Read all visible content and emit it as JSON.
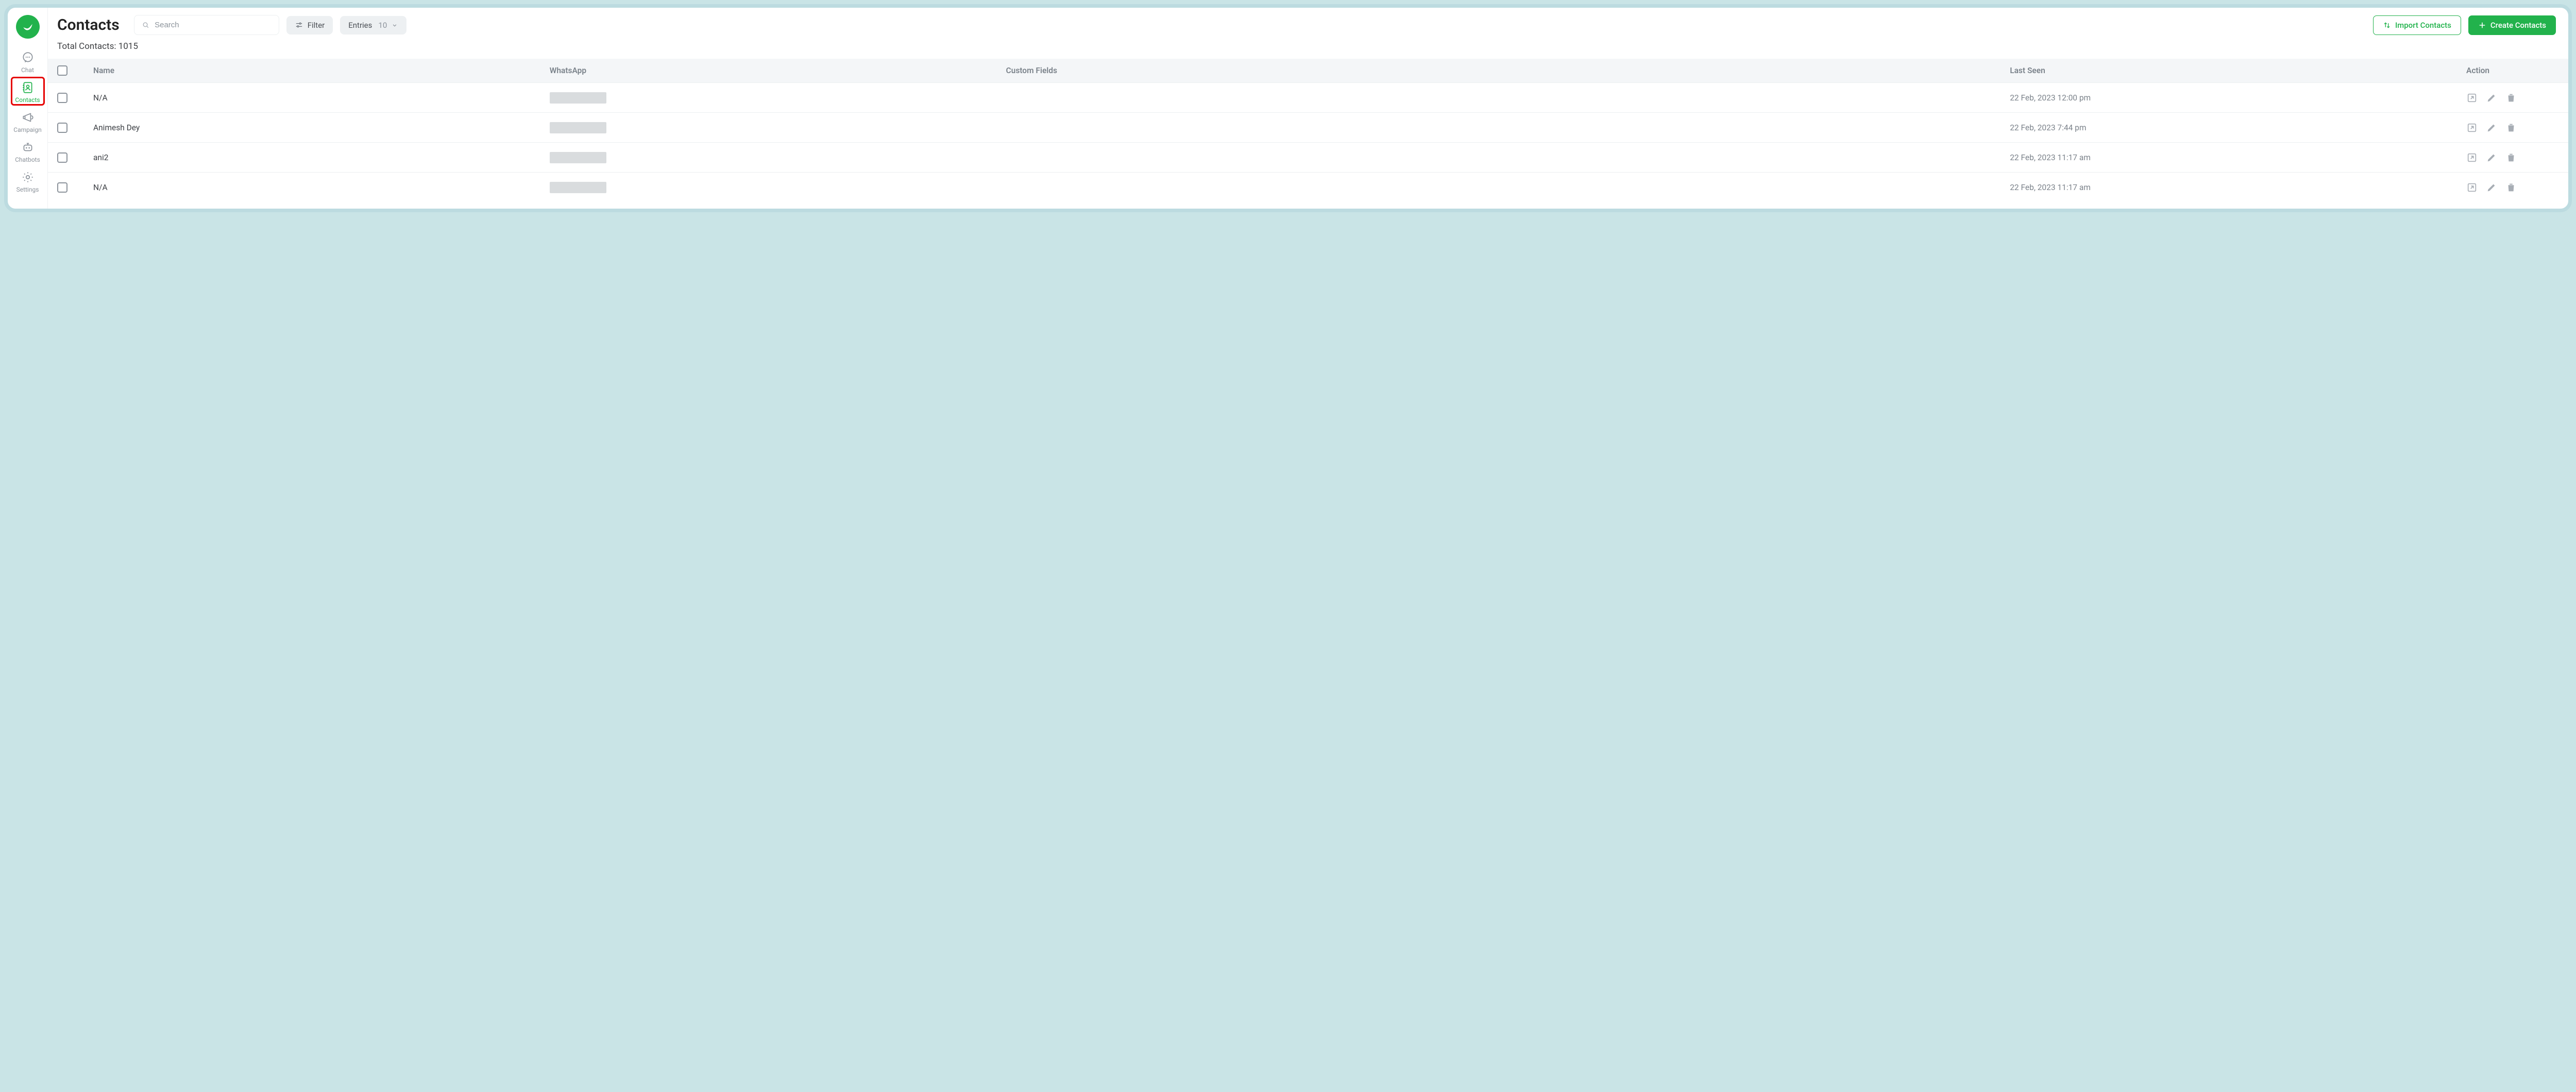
{
  "sidebar": {
    "items": [
      {
        "icon": "chat",
        "label": "Chat"
      },
      {
        "icon": "contacts",
        "label": "Contacts",
        "active": true,
        "highlight": true
      },
      {
        "icon": "campaign",
        "label": "Campaign"
      },
      {
        "icon": "chatbots",
        "label": "Chatbots"
      },
      {
        "icon": "settings",
        "label": "Settings"
      }
    ]
  },
  "header": {
    "title": "Contacts",
    "search_placeholder": "Search",
    "filter_label": "Filter",
    "entries_label": "Entries",
    "entries_value": "10",
    "import_label": "Import Contacts",
    "create_label": "Create Contacts"
  },
  "summary": {
    "total_label": "Total Contacts:",
    "total_value": "1015"
  },
  "table": {
    "columns": [
      "",
      "Name",
      "WhatsApp",
      "Custom Fields",
      "Last Seen",
      "Action"
    ],
    "rows": [
      {
        "name": "N/A",
        "whatsapp": "[redacted]",
        "custom": "",
        "lastseen": "22 Feb, 2023 12:00 pm"
      },
      {
        "name": "Animesh Dey",
        "whatsapp": "[redacted]",
        "custom": "",
        "lastseen": "22 Feb, 2023 7:44 pm"
      },
      {
        "name": "ani2",
        "whatsapp": "[redacted]",
        "custom": "",
        "lastseen": "22 Feb, 2023 11:17 am"
      },
      {
        "name": "N/A",
        "whatsapp": "[redacted]",
        "custom": "",
        "lastseen": "22 Feb, 2023 11:17 am"
      }
    ]
  }
}
